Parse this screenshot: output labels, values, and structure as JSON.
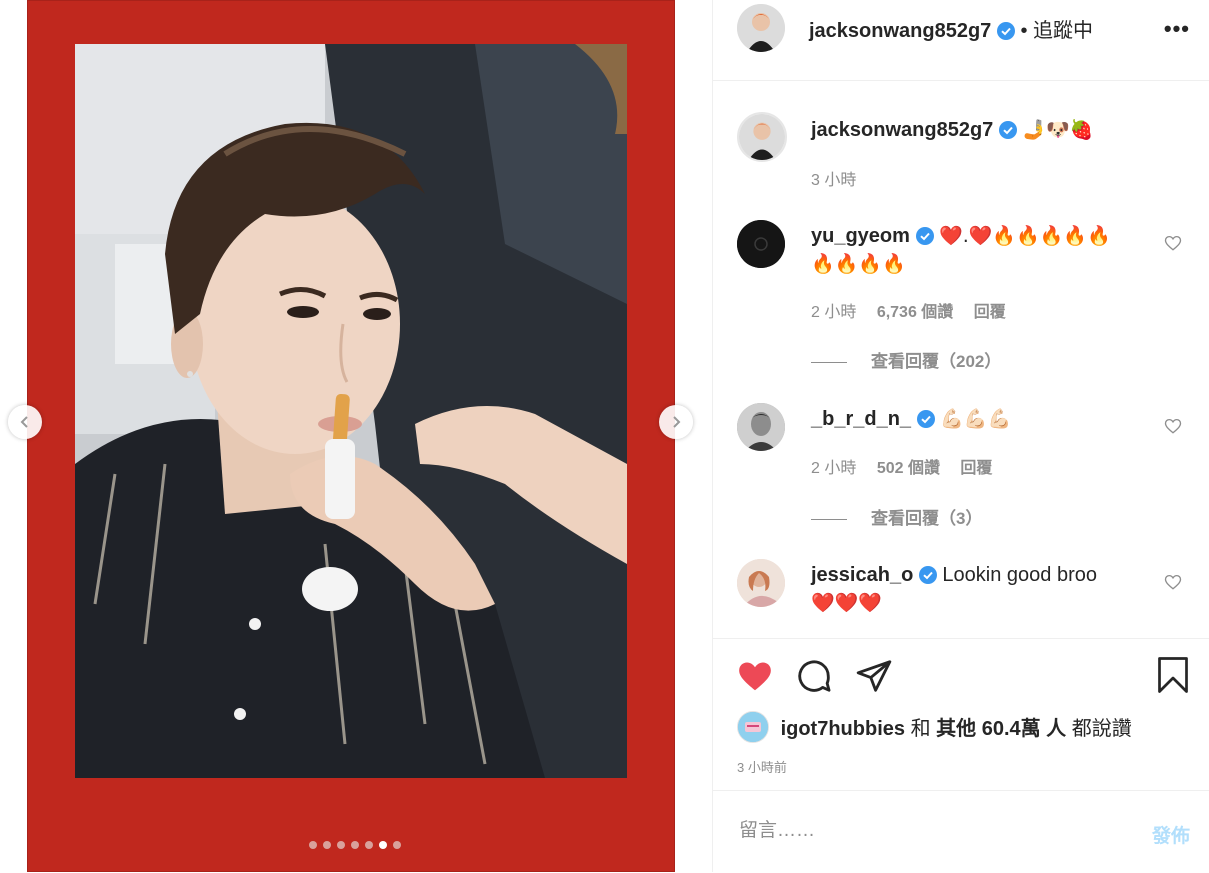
{
  "post": {
    "header": {
      "username": "jacksonwang852g7",
      "separator": "•",
      "follow_status": "追蹤中",
      "more": "•••"
    },
    "caption": {
      "username": "jacksonwang852g7",
      "emojis": "🤳🐶🍓",
      "time": "3 小時"
    },
    "comments": [
      {
        "username": "yu_gyeom",
        "text_line1": "❤️.❤️🔥🔥🔥🔥🔥",
        "text_line2": "🔥🔥🔥🔥",
        "time": "2 小時",
        "likes": "6,736 個讚",
        "reply": "回覆",
        "view_replies": "查看回覆（202）"
      },
      {
        "username": "_b_r_d_n_",
        "text_line1": "💪🏻💪🏻💪🏻",
        "time": "2 小時",
        "likes": "502 個讚",
        "reply": "回覆",
        "view_replies": "查看回覆（3）"
      },
      {
        "username": "jessicah_o",
        "text_line1": "Lookin good broo",
        "text_line2": "❤️❤️❤️"
      }
    ],
    "likes_summary": {
      "liker": "igot7hubbies",
      "and": "和",
      "others": "其他 60.4萬 人",
      "suffix": "都說讚"
    },
    "time_ago": "3 小時前",
    "comment_input": {
      "placeholder": "留言……",
      "post_label": "發佈"
    },
    "carousel": {
      "total": 7,
      "active": 6
    },
    "colors": {
      "frame_red": "#c0281e",
      "like_red": "#ed4956",
      "verified_blue": "#3897f0",
      "post_disabled": "#b2dffc"
    }
  }
}
